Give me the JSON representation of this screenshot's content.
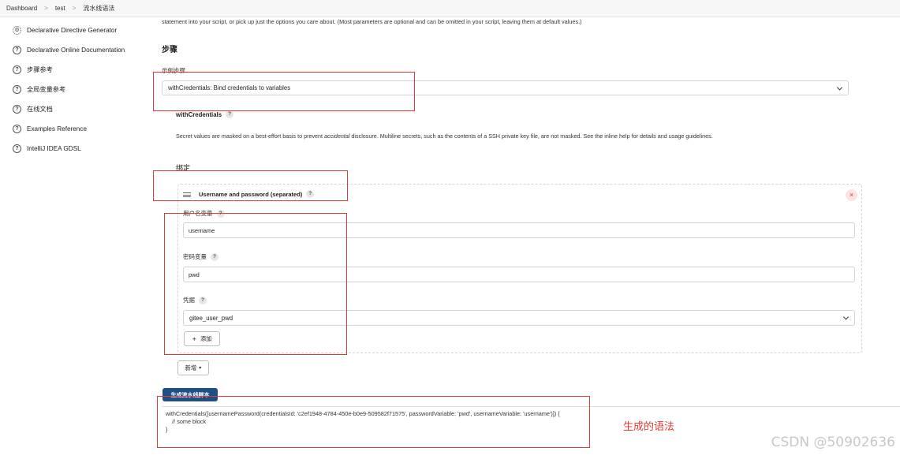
{
  "breadcrumb": [
    "Dashboard",
    "test",
    "流水线语法"
  ],
  "sidebar": {
    "items": [
      {
        "label": "Declarative Directive Generator",
        "icon": "gear-icon"
      },
      {
        "label": "Declarative Online Documentation",
        "icon": "help-icon"
      },
      {
        "label": "步骤参考",
        "icon": "help-icon"
      },
      {
        "label": "全局变量参考",
        "icon": "help-icon"
      },
      {
        "label": "在线文档",
        "icon": "help-icon"
      },
      {
        "label": "Examples Reference",
        "icon": "help-icon"
      },
      {
        "label": "IntelliJ IDEA GDSL",
        "icon": "help-icon"
      }
    ]
  },
  "main": {
    "intro_text": "statement into your script, or pick up just the options you care about. (Most parameters are optional and can be omitted in your script, leaving them at default values.)",
    "steps_heading": "步骤",
    "sample_step_label": "示例步骤",
    "sample_step_value": "withCredentials: Bind credentials to variables",
    "with_credentials_title": "withCredentials",
    "description": "Secret values are masked on a best-effort basis to prevent accidental disclosure. Multiline secrets, such as the contents of a SSH private key file, are not masked. See the inline help for details and usage guidelines.",
    "description_emph": "accidental",
    "bindings_heading": "绑定",
    "binding": {
      "title": "Username and password (separated)",
      "username_var_label": "用户名变量",
      "username_var_value": "username",
      "password_var_label": "密码变量",
      "password_var_value": "pwd",
      "credentials_label": "凭据",
      "credentials_value": "gitee_user_pwd",
      "add_button": "添加",
      "delete_glyph": "×"
    },
    "new_binding_button": "新增",
    "generate_button": "生成流水线脚本",
    "generated_code": [
      "withCredentials([usernamePassword(credentialsId: 'c2ef1948-4784-450e-b0e9-509582f71575', passwordVariable: 'pwd', usernameVariable: 'username')]) {",
      "    // some block",
      "}"
    ]
  },
  "annotation": {
    "text": "生成的语法",
    "color": "#e53935"
  },
  "watermark": "CSDN @50902636",
  "colors": {
    "primary_button": "#1f4f86",
    "annotation_red": "#e53935"
  }
}
